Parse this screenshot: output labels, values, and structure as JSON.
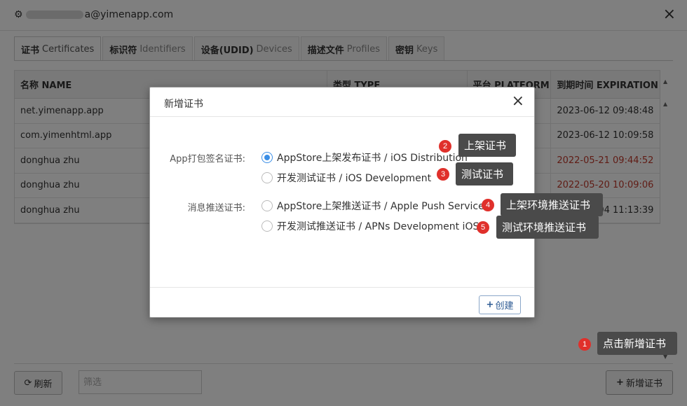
{
  "window": {
    "account_suffix": "a@yimenapp.com",
    "close_glyph": "×"
  },
  "tabs": [
    {
      "cn": "证书",
      "en": "Certificates"
    },
    {
      "cn": "标识符",
      "en": "Identifiers"
    },
    {
      "cn": "设备(UDID)",
      "en": "Devices"
    },
    {
      "cn": "描述文件",
      "en": "Profiles"
    },
    {
      "cn": "密钥",
      "en": "Keys"
    }
  ],
  "table": {
    "headers": [
      "名称 NAME",
      "类型 TYPE",
      "平台 PLATFORM",
      "到期时间 EXPIRATION"
    ],
    "rows": [
      {
        "name": "net.yimenapp.app",
        "expiration": "2023-06-12 09:48:48",
        "expired": false
      },
      {
        "name": "com.yimenhtml.app",
        "expiration": "2023-06-12 10:09:58",
        "expired": false
      },
      {
        "name": "donghua zhu",
        "expiration": "2022-05-21 09:44:52",
        "expired": true
      },
      {
        "name": "donghua zhu",
        "expiration": "2022-05-20 10:09:06",
        "expired": true
      },
      {
        "name": "donghua zhu",
        "expiration": "2022-05-04 11:13:39",
        "expired": false
      }
    ]
  },
  "toolbar": {
    "refresh_label": "刷新",
    "filter_placeholder": "筛选",
    "add_label": "新增证书"
  },
  "modal": {
    "title": "新增证书",
    "close_glyph": "×",
    "sign_label": "App打包签名证书:",
    "push_label": "消息推送证书:",
    "options": {
      "appstore": "AppStore上架发布证书 / iOS Distribution",
      "dev": "开发测试证书 / iOS Development",
      "push": "AppStore上架推送证书 / Apple Push Services",
      "apns_dev": "开发测试推送证书 / APNs Development iOS"
    },
    "create_label": "创建"
  },
  "callouts": [
    {
      "num": "1",
      "text": "点击新增证书"
    },
    {
      "num": "2",
      "text": "上架证书"
    },
    {
      "num": "3",
      "text": "测试证书"
    },
    {
      "num": "4",
      "text": "上架环境推送证书"
    },
    {
      "num": "5",
      "text": "测试环境推送证书"
    }
  ],
  "colors": {
    "accent": "#3a8ee6",
    "expired": "#c0392b",
    "badge": "#e0302b",
    "callout_bg": "#4a4a4a"
  }
}
